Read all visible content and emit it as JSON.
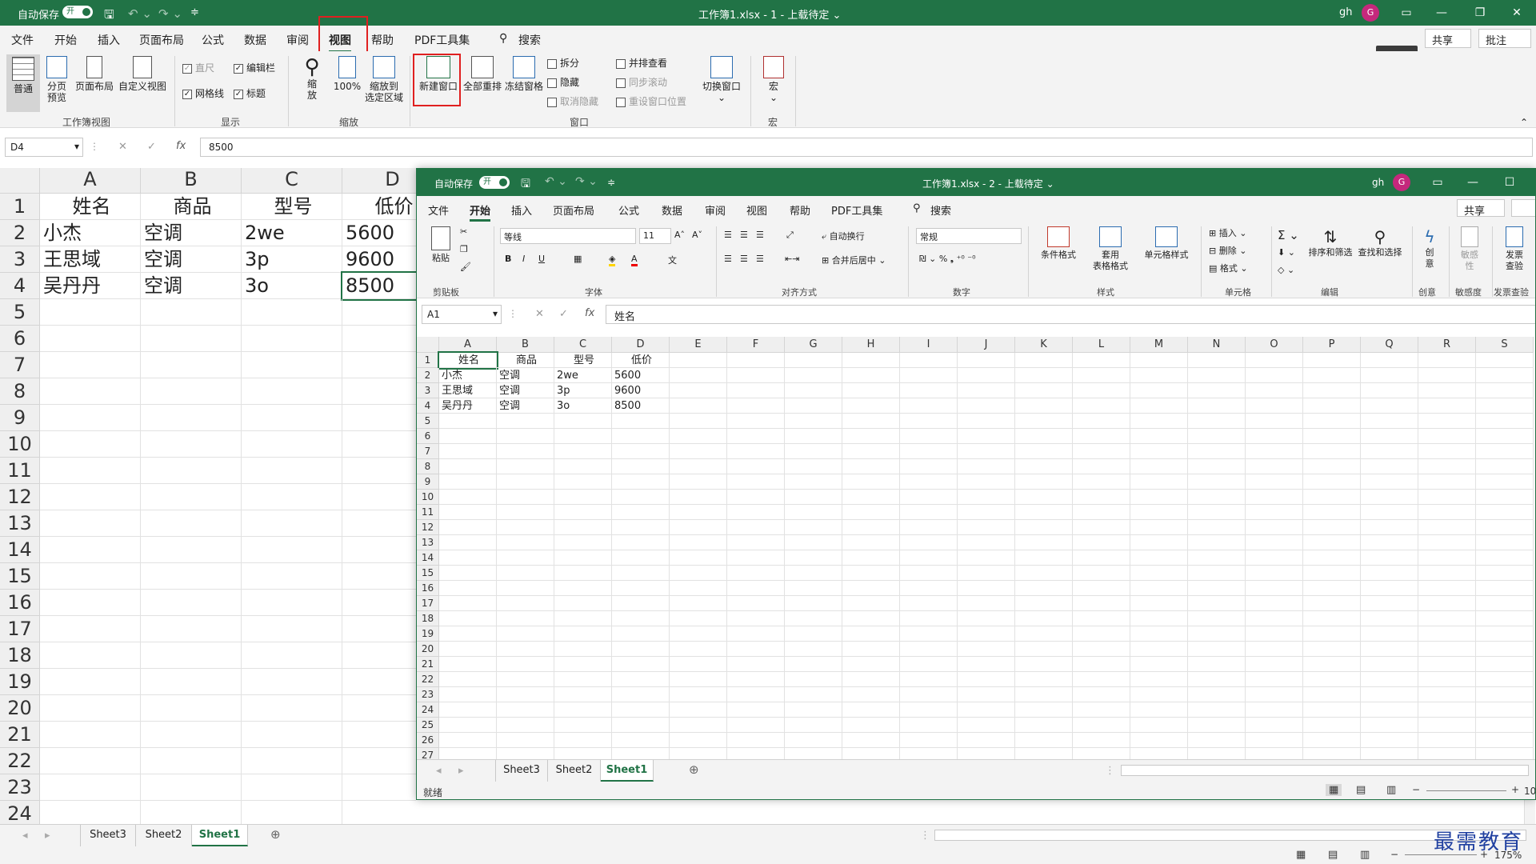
{
  "main": {
    "autosave_label": "自动保存",
    "toggle_label": "开",
    "title": "工作簿1.xlsx  -  1  -  上载待定 ⌄",
    "user": "gh",
    "avatar": "G",
    "menus": [
      "文件",
      "开始",
      "插入",
      "页面布局",
      "公式",
      "数据",
      "审阅",
      "视图",
      "帮助",
      "PDF工具集"
    ],
    "search": "搜索",
    "share": "共享",
    "comment": "批注",
    "ribbon": {
      "normal": "普通",
      "pagebreak": "分页\n预览",
      "pagelayout": "页面布局",
      "customview": "自定义视图",
      "group_workbook": "工作簿视图",
      "ruler": "直尺",
      "formulabar": "编辑栏",
      "gridlines": "网格线",
      "headings": "标题",
      "group_show": "显示",
      "zoom": "缩\n放",
      "zoom100": "100%",
      "zoomsel": "缩放到\n选定区域",
      "group_zoom": "缩放",
      "newwin": "新建窗口",
      "arrange": "全部重排",
      "freeze": "冻结窗格",
      "split": "拆分",
      "hide": "隐藏",
      "unhide": "取消隐藏",
      "sidebyside": "并排查看",
      "syncscroll": "同步滚动",
      "resetpos": "重设窗口位置",
      "switch": "切换窗口",
      "group_window": "窗口",
      "macro": "宏",
      "group_macro": "宏"
    },
    "namebox": "D4",
    "formula": "8500",
    "columns": [
      "A",
      "B",
      "C",
      "D"
    ],
    "rows": [
      "1",
      "2",
      "3",
      "4",
      "5",
      "6",
      "7",
      "8",
      "9",
      "10",
      "11",
      "12",
      "13",
      "14",
      "15",
      "16",
      "17",
      "18",
      "19",
      "20",
      "21",
      "22",
      "23",
      "24"
    ],
    "cells": [
      [
        "姓名",
        "商品",
        "型号",
        "低价"
      ],
      [
        "小杰",
        "空调",
        "2we",
        "5600"
      ],
      [
        "王思域",
        "空调",
        "3p",
        "9600"
      ],
      [
        "吴丹丹",
        "空调",
        "3o",
        "8500"
      ]
    ],
    "sheets": [
      "Sheet3",
      "Sheet2",
      "Sheet1"
    ],
    "zoom_label": "175%"
  },
  "win2": {
    "autosave_label": "自动保存",
    "toggle_label": "开",
    "title": "工作簿1.xlsx  -  2  -  上载待定 ⌄",
    "user": "gh",
    "avatar": "G",
    "menus": [
      "文件",
      "开始",
      "插入",
      "页面布局",
      "公式",
      "数据",
      "审阅",
      "视图",
      "帮助",
      "PDF工具集"
    ],
    "search": "搜索",
    "share": "共享",
    "ribbon": {
      "paste": "粘贴",
      "clipboard": "剪贴板",
      "font_name": "等线",
      "font_size": "11",
      "font": "字体",
      "wrap": "自动换行",
      "merge": "合并后居中",
      "align": "对齐方式",
      "numfmt": "常规",
      "number": "数字",
      "cond": "条件格式",
      "table": "套用\n表格格式",
      "cellstyle": "单元格样式",
      "styles": "样式",
      "insert": "插入",
      "delete": "删除",
      "format": "格式",
      "cellsgrp": "单元格",
      "sort": "排序和筛选",
      "find": "查找和选择",
      "edit": "编辑",
      "create": "创\n意",
      "creategrp": "创意",
      "sens": "敏感\n性",
      "sensgrp": "敏感度",
      "invoice": "发票\n查验",
      "invoicegrp": "发票查验"
    },
    "namebox": "A1",
    "formula": "姓名",
    "columns": [
      "A",
      "B",
      "C",
      "D",
      "E",
      "F",
      "G",
      "H",
      "I",
      "J",
      "K",
      "L",
      "M",
      "N",
      "O",
      "P",
      "Q",
      "R",
      "S"
    ],
    "rows": [
      "1",
      "2",
      "3",
      "4",
      "5",
      "6",
      "7",
      "8",
      "9",
      "10",
      "11",
      "12",
      "13",
      "14",
      "15",
      "16",
      "17",
      "18",
      "19",
      "20",
      "21",
      "22",
      "23",
      "24",
      "25",
      "26",
      "27"
    ],
    "sheets": [
      "Sheet3",
      "Sheet2",
      "Sheet1"
    ],
    "status": "就绪",
    "zoom_label": "10"
  },
  "watermark": "最需教育",
  "colors": {
    "accent": "#217346",
    "highlight": "#e02020"
  }
}
